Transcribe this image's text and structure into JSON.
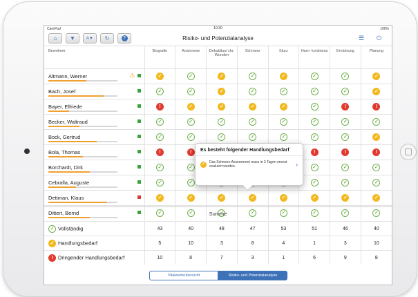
{
  "status": {
    "carrier": "CarePad",
    "time": "10:30",
    "battery": "100%"
  },
  "toolbar": {
    "title": "Risiko- und Potenzialanalyse"
  },
  "columns": [
    "Bewohner",
    "Biografie",
    "Anamnese",
    "Dekubitus/ chr. Wunden",
    "Schmerz",
    "Sturz",
    "Harn- kontinenz",
    "Ernährung",
    "Planung"
  ],
  "residents": [
    {
      "name": "Altmann, Werner",
      "progress": 0.55,
      "flag": "#3aa33a",
      "warning": true,
      "cells": [
        "h",
        "ok",
        "h",
        "ok",
        "h",
        "ok",
        "ok",
        "h"
      ]
    },
    {
      "name": "Bach, Josef",
      "progress": 0.8,
      "flag": "#3aa33a",
      "warning": false,
      "cells": [
        "ok",
        "ok",
        "h",
        "ok",
        "ok",
        "ok",
        "ok",
        "h"
      ]
    },
    {
      "name": "Bayer, Elfriede",
      "progress": 0.3,
      "flag": "#3aa33a",
      "warning": false,
      "cells": [
        "d",
        "h",
        "h",
        "h",
        "h",
        "ok",
        "d",
        "d"
      ]
    },
    {
      "name": "Becker, Waltraud",
      "progress": 0.45,
      "flag": "#3aa33a",
      "warning": false,
      "cells": [
        "ok",
        "ok",
        "ok",
        "ok",
        "ok",
        "ok",
        "ok",
        "ok"
      ]
    },
    {
      "name": "Bock, Gertrud",
      "progress": 0.7,
      "flag": "#3aa33a",
      "warning": false,
      "cells": [
        "ok",
        "ok",
        "ok",
        "ok",
        "ok",
        "ok",
        "ok",
        "h"
      ]
    },
    {
      "name": "Bola, Thomas",
      "progress": 0.5,
      "flag": "#3aa33a",
      "warning": false,
      "cells": [
        "d",
        "d",
        "d",
        "d",
        "d",
        "d",
        "d",
        "d"
      ]
    },
    {
      "name": "Borchardt, Dirk",
      "progress": 0.6,
      "flag": "#3aa33a",
      "warning": false,
      "cells": [
        "ok",
        "ok",
        "ok",
        "ok",
        "ok",
        "ok",
        "ok",
        "ok"
      ]
    },
    {
      "name": "Cebralla, Auguste",
      "progress": 0.4,
      "flag": "#3aa33a",
      "warning": false,
      "cells": [
        "ok",
        "ok",
        "ok",
        "ok",
        "ok",
        "ok",
        "ok",
        "ok"
      ]
    },
    {
      "name": "Dettman, Klaus",
      "progress": 0.85,
      "flag": "#d63b2f",
      "warning": false,
      "cells": [
        "h",
        "h",
        "h",
        "h",
        "h",
        "h",
        "h",
        "h"
      ]
    },
    {
      "name": "Dittert, Bernd",
      "progress": 0.6,
      "flag": "#3aa33a",
      "warning": false,
      "cells": [
        "ok",
        "ok",
        "ok",
        "ok",
        "ok",
        "ok",
        "ok",
        "ok"
      ]
    }
  ],
  "summary": {
    "title": "Summe",
    "rows": [
      {
        "label": "Vollständig",
        "type": "ok",
        "values": [
          "43",
          "40",
          "48",
          "47",
          "53",
          "51",
          "46",
          "40"
        ]
      },
      {
        "label": "Handlungsbedarf",
        "type": "h",
        "values": [
          "5",
          "10",
          "3",
          "8",
          "4",
          "1",
          "3",
          "10"
        ]
      },
      {
        "label": "Dringender Handlungsbedarf",
        "type": "d",
        "values": [
          "10",
          "8",
          "7",
          "3",
          "1",
          "6",
          "9",
          "8"
        ]
      }
    ]
  },
  "popup": {
    "title": "Es besteht folgender Handlungsbedarf",
    "message": "Das Schmerz-Assessment muss in 3 Tagen erneut evaluiert werden."
  },
  "tabs": {
    "inactive": "Vitalwerteübersicht",
    "active": "Risiko- und Potenzialanalyse"
  }
}
